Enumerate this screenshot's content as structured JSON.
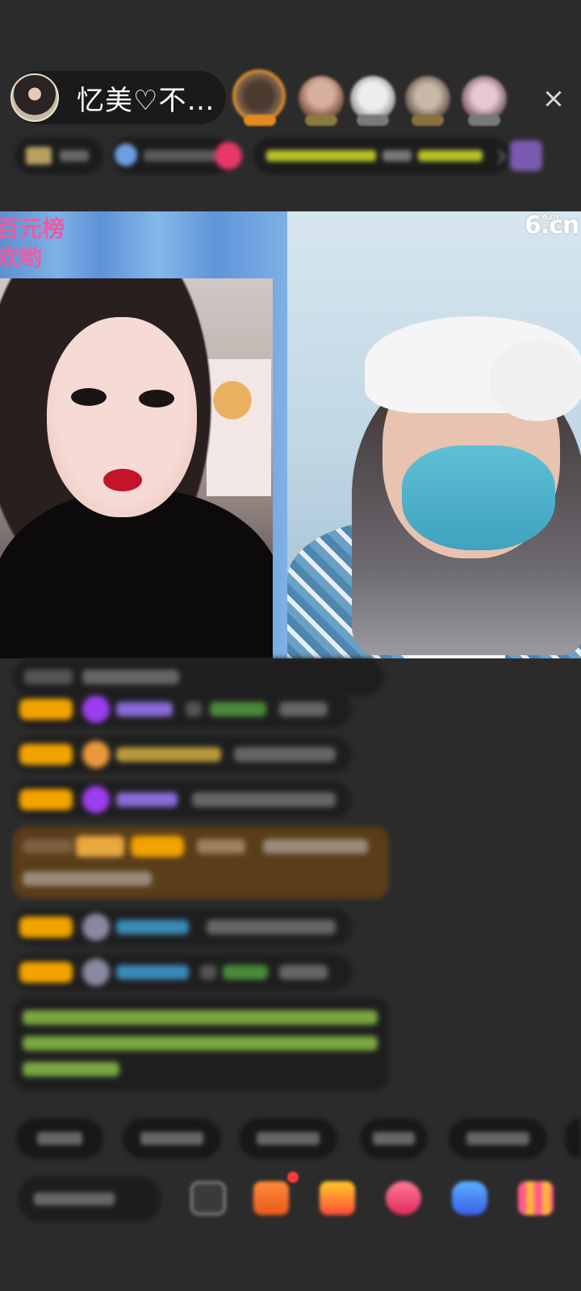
{
  "header": {
    "host_name": "忆美♡不…",
    "close_label": "×"
  },
  "video": {
    "left_overlay_text": [
      "百元榜",
      "欢哟"
    ],
    "watermark": "6.cn",
    "watermark_small": "6.cn"
  },
  "viewers": [
    {
      "name": "viewer-1",
      "color": "#c97a2a"
    },
    {
      "name": "viewer-2",
      "color": "#b99a8a"
    },
    {
      "name": "viewer-3",
      "color": "#d8d0cc"
    },
    {
      "name": "viewer-4",
      "color": "#a89070"
    },
    {
      "name": "viewer-5",
      "color": "#c8a6b4"
    }
  ],
  "colors": {
    "badge": "#f2a300",
    "chat_bg": "#1e1e1f",
    "highlight_msg_bg": "#5a3d1a",
    "notice_text": "#8fce3a",
    "name_purple": "#9d6cff",
    "name_orange": "#e9a63a",
    "name_cyan": "#35a9d6"
  },
  "icons": {
    "close": "close-icon",
    "emoji": "emoji-icon",
    "gift_box": "gift-box-icon",
    "gift_bag": "gift-bag-icon",
    "heart": "heart-icon",
    "game_controller": "game-controller-icon",
    "more_grid": "more-grid-icon"
  }
}
